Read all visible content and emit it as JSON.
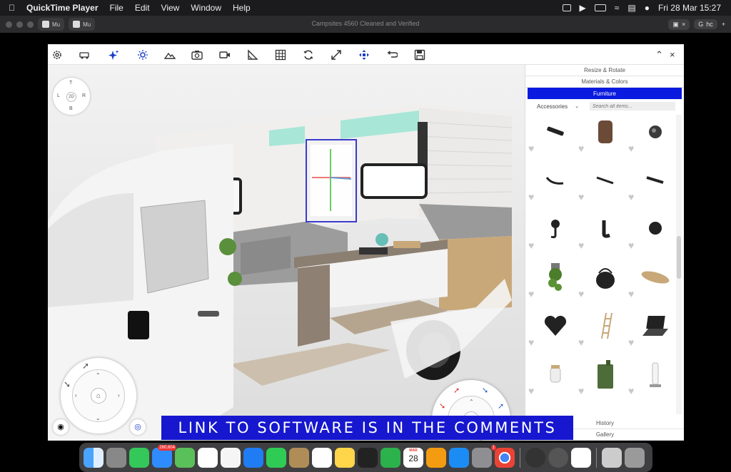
{
  "menubar": {
    "app_name": "QuickTime Player",
    "menus": [
      "File",
      "Edit",
      "View",
      "Window",
      "Help"
    ],
    "datetime": "Fri 28 Mar  15:27"
  },
  "browser": {
    "window_title": "Campsites 4560 Cleaned and Verified",
    "left_tabs": [
      "Mu",
      "Mu"
    ],
    "right_tabs": [
      "hc"
    ]
  },
  "toolbar": {
    "icons": [
      "gear-icon",
      "van-icon",
      "sparkle-icon",
      "sun-icon",
      "mountain-icon",
      "camera-icon",
      "video-icon",
      "ruler-angle-icon",
      "grid-icon",
      "rotate-icon",
      "expand-icon",
      "move-icon",
      "undo-icon",
      "save-icon"
    ]
  },
  "navcube": {
    "top": "T",
    "left": "L",
    "center": "2D",
    "right": "R",
    "bottom": "B"
  },
  "panel": {
    "tabs": [
      "Resize & Rotate",
      "Materials & Colors",
      "Furniture"
    ],
    "active_tab": "Furniture",
    "category": "Accessories",
    "search_placeholder": "Search all items...",
    "bottom_tabs": [
      "History",
      "Gallery"
    ],
    "items": [
      "rail-bar",
      "wall-bag",
      "round-knob",
      "curved-hook",
      "bar-handle",
      "flat-handle",
      "coat-hook",
      "j-hook",
      "door-knob",
      "hanging-plant",
      "kettle",
      "cutting-board",
      "heart-cushion",
      "ladder",
      "laptop",
      "jar",
      "jerry-can",
      "paper-towel-holder"
    ]
  },
  "banner": {
    "text": "LINK TO SOFTWARE IS IN THE COMMENTS"
  },
  "dock": {
    "mail_badge": "260,604",
    "calendar_month": "MAR",
    "calendar_day": "28",
    "settings_badge": "1",
    "apps": [
      "finder",
      "launchpad",
      "messages",
      "mail",
      "maps",
      "photos",
      "freeform",
      "keynote",
      "facetime",
      "notes-app",
      "reminders",
      "notes",
      "davinci",
      "numbers",
      "calendar",
      "pages",
      "app-store",
      "settings",
      "chrome",
      "infuse",
      "quicktime",
      "drive",
      "preview",
      "trash"
    ]
  },
  "colors": {
    "accent": "#0a1adf",
    "banner": "#1617ce",
    "toolbar_icon_active": "#1a3cc8"
  }
}
